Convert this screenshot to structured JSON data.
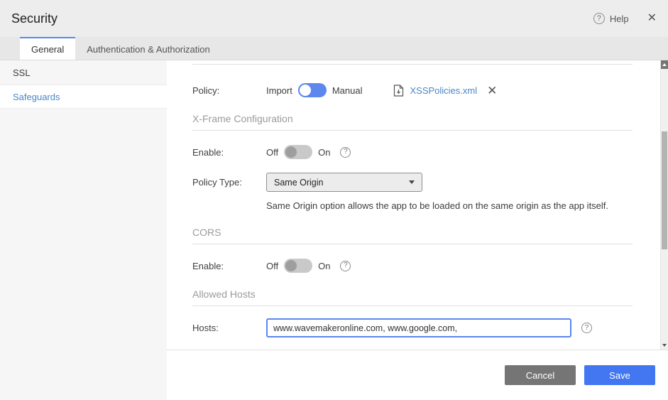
{
  "header": {
    "title": "Security",
    "help_label": "Help"
  },
  "tabs": [
    {
      "label": "General",
      "active": true
    },
    {
      "label": "Authentication & Authorization",
      "active": false
    }
  ],
  "sidebar": {
    "items": [
      {
        "label": "SSL",
        "active": false
      },
      {
        "label": "Safeguards",
        "active": true
      }
    ]
  },
  "content": {
    "policy": {
      "label": "Policy:",
      "import_label": "Import",
      "manual_label": "Manual",
      "selected": "Import",
      "file_name": "XSSPolicies.xml"
    },
    "xframe": {
      "heading": "X-Frame Configuration",
      "enable_label": "Enable:",
      "off_label": "Off",
      "on_label": "On",
      "enable_state": "Off",
      "policy_type_label": "Policy Type:",
      "policy_type_value": "Same Origin",
      "help_text": "Same Origin option allows the app to be loaded on the same origin as the app itself."
    },
    "cors": {
      "heading": "CORS",
      "enable_label": "Enable:",
      "off_label": "Off",
      "on_label": "On",
      "enable_state": "Off"
    },
    "allowed_hosts": {
      "heading": "Allowed Hosts",
      "hosts_label": "Hosts:",
      "hosts_value": "www.wavemakeronline.com, www.google.com, "
    }
  },
  "footer": {
    "cancel_label": "Cancel",
    "save_label": "Save"
  },
  "colors": {
    "accent_blue": "#5b87ee",
    "link_blue": "#4a86c8",
    "save_blue": "#4377f1",
    "cancel_gray": "#757575"
  }
}
